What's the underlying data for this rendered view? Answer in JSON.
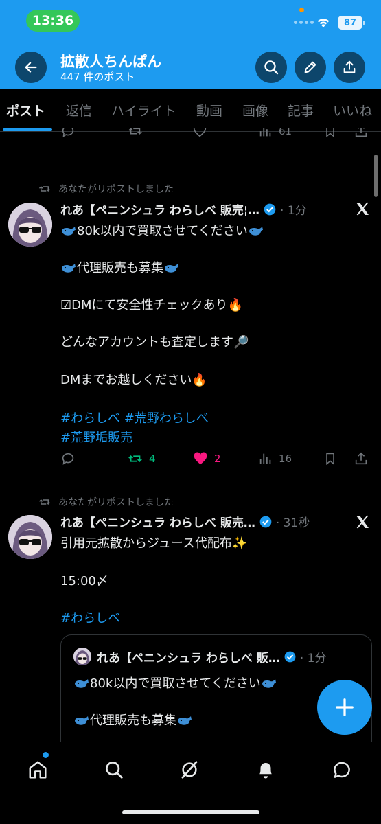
{
  "status_bar": {
    "time": "13:36",
    "battery": "87"
  },
  "header": {
    "title": "拡散人ちんぱん",
    "subtitle": "447 件のポスト"
  },
  "tabs": [
    "ポスト",
    "返信",
    "ハイライト",
    "動画",
    "画像",
    "記事",
    "いいね"
  ],
  "prev_post": {
    "views": "61"
  },
  "posts": [
    {
      "repost_label": "あなたがリポストしました",
      "name": "れあ【ペニンシュラ わらしべ 販売¦…",
      "time": "· 1分",
      "lines": [
        "80k以内で買取させてください",
        "代理販売も募集",
        "☑DMにて安全性チェックあり🔥",
        "どんなアカウントも査定します🔎",
        "DMまでお越しください🔥"
      ],
      "hashtags_line1": "#わらしべ #荒野わらしべ",
      "hashtags_line2": "#荒野垢販売",
      "reposts": "4",
      "likes": "2",
      "views": "16"
    },
    {
      "repost_label": "あなたがリポストしました",
      "name": "れあ【ペニンシュラ わらしべ 販売…",
      "time": "· 31秒",
      "lines": [
        "引用元拡散からジュース代配布✨",
        "15:00〆"
      ],
      "hashtag": "#わらしべ",
      "quote": {
        "name": "れあ【ペニンシュラ わらしべ 販…",
        "time": "· 1分",
        "lines": [
          "80k以内で買取させてください",
          "代理販売も募集"
        ]
      }
    }
  ],
  "colors": {
    "accent": "#1d9bf0",
    "like": "#f91880",
    "repost": "#00ba7c"
  }
}
